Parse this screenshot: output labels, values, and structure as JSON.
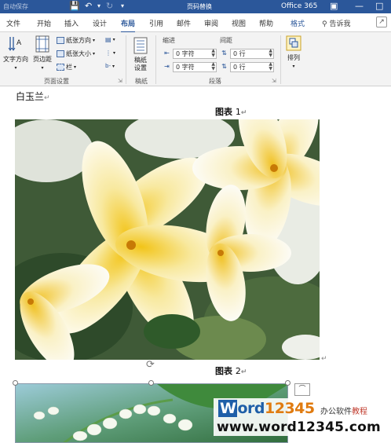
{
  "titlebar": {
    "autosave": "自动保存",
    "autosave_state": "关",
    "document_title": "页码替换",
    "app_name": "Office 365"
  },
  "tabs": [
    {
      "label": "文件"
    },
    {
      "label": "开始"
    },
    {
      "label": "插入"
    },
    {
      "label": "设计"
    },
    {
      "label": "布局"
    },
    {
      "label": "引用"
    },
    {
      "label": "邮件"
    },
    {
      "label": "审阅"
    },
    {
      "label": "视图"
    },
    {
      "label": "帮助"
    },
    {
      "label": "格式"
    }
  ],
  "active_tab": "布局",
  "tell_me": "告诉我",
  "ribbon": {
    "page_setup": {
      "text_direction": "文字方向",
      "margins": "页边距",
      "orientation": "纸张方向",
      "size": "纸张大小",
      "columns": "栏",
      "label": "页面设置"
    },
    "draft": {
      "button": "稿纸\n设置",
      "label": "稿纸"
    },
    "paragraph": {
      "indent_label": "缩进",
      "spacing_label": "间距",
      "indent_left": "0 字符",
      "indent_right": "0 字符",
      "spacing_before": "0 行",
      "spacing_after": "0 行",
      "label": "段落"
    },
    "arrange": {
      "button": "排列"
    }
  },
  "document": {
    "heading": "白玉兰",
    "caption1_label": "图表",
    "caption1_number": "1",
    "caption2_label": "图表",
    "caption2_number": "2"
  },
  "watermark": {
    "brand_w": "W",
    "brand_ord": "ord",
    "brand_num": "12345",
    "tagline_a": "办公软件",
    "tagline_b": "教程",
    "url": "www.word12345.com"
  },
  "colors": {
    "accent": "#2b579a",
    "ribbon_bg": "#f3f3f3"
  }
}
